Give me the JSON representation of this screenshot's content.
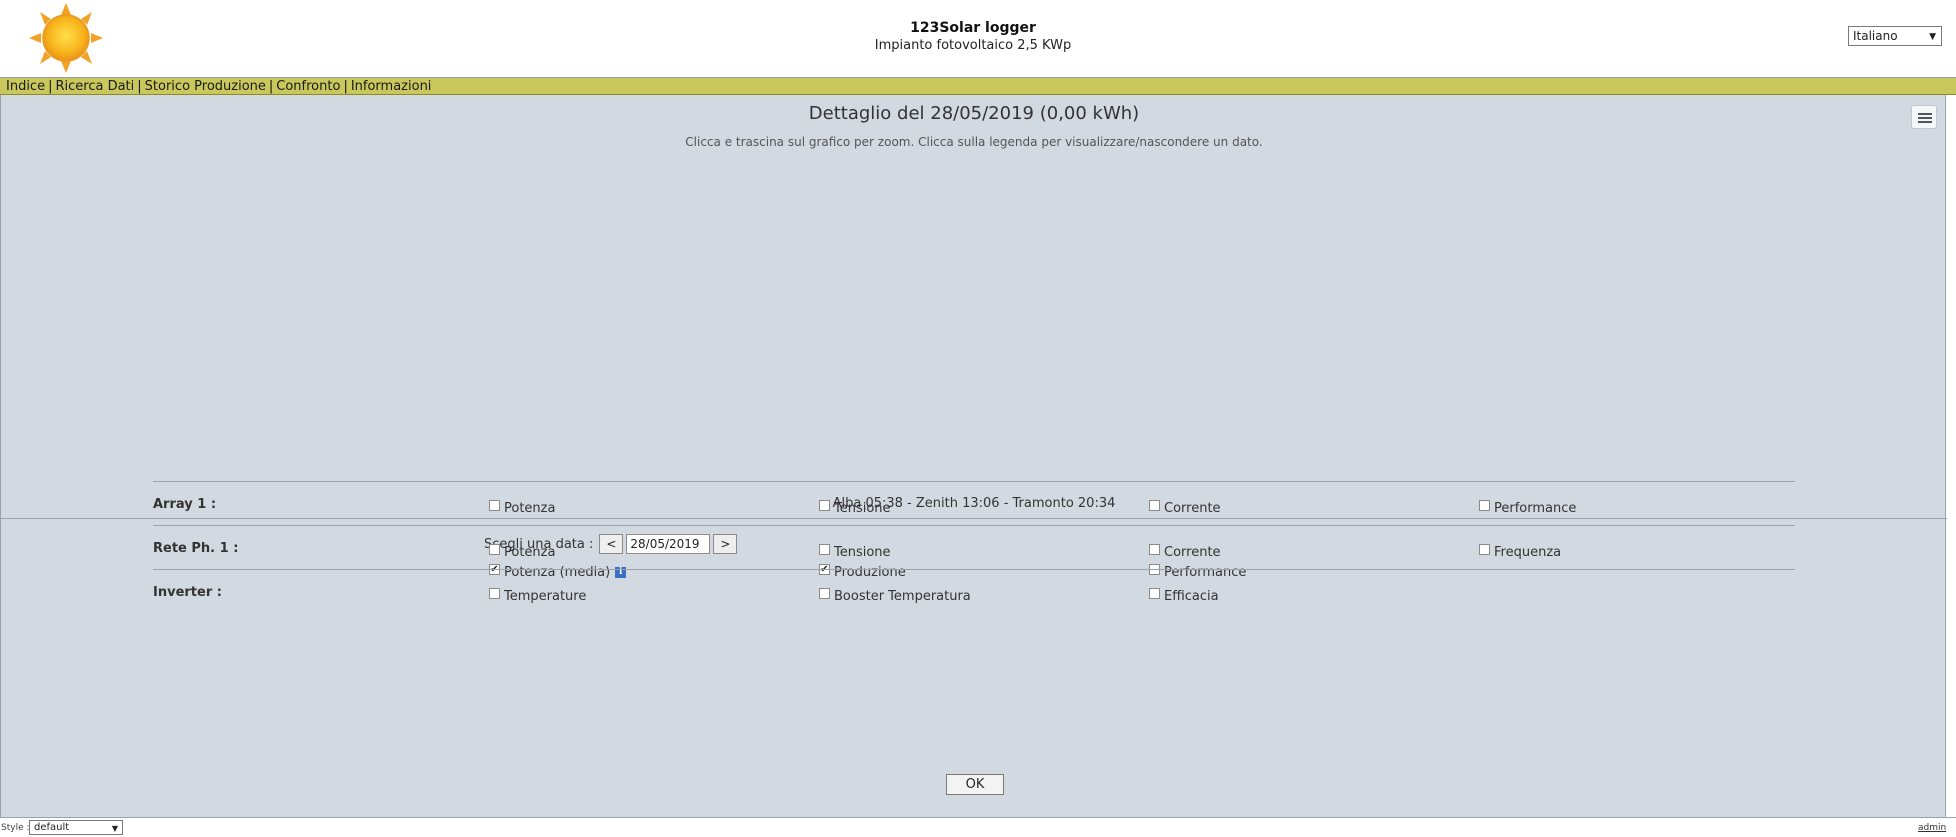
{
  "header": {
    "title": "123Solar logger",
    "subtitle": "Impianto fotovoltaico 2,5 KWp",
    "language_selected": "Italiano",
    "logo_icon": "sun-icon"
  },
  "menu": {
    "items": [
      {
        "label": "Indice"
      },
      {
        "label": "Ricerca Dati"
      },
      {
        "label": "Storico Produzione"
      },
      {
        "label": "Confronto"
      },
      {
        "label": "Informazioni"
      }
    ],
    "separator": "|",
    "background": "#c9c85c"
  },
  "chart": {
    "title": "Dettaglio del 28/05/2019 (0,00 kWh)",
    "subtitle": "Clicca e trascina sul grafico per zoom. Clicca sulla legenda per visualizzare/nascondere un dato.",
    "menu_icon": "hamburger-menu-icon",
    "sun_info": "Alba 05:38 - Zenith 13:06 - Tramonto 20:34"
  },
  "controls": {
    "date_label": "Scegli una data :",
    "prev_label": "<",
    "next_label": ">",
    "date_value": "28/05/2019",
    "main_options": [
      {
        "label": "Potenza (media)",
        "checked": true,
        "info": "i"
      },
      {
        "label": "Produzione",
        "checked": true
      },
      {
        "label": "Performance",
        "checked": false
      }
    ],
    "array1": {
      "label": "Array 1 :",
      "options": [
        {
          "label": "Potenza",
          "checked": false
        },
        {
          "label": "Tensione",
          "checked": false
        },
        {
          "label": "Corrente",
          "checked": false
        },
        {
          "label": "Performance",
          "checked": false
        }
      ]
    },
    "grid": {
      "label": "Rete Ph. 1 :",
      "options": [
        {
          "label": "Potenza",
          "checked": false
        },
        {
          "label": "Tensione",
          "checked": false
        },
        {
          "label": "Corrente",
          "checked": false
        },
        {
          "label": "Frequenza",
          "checked": false
        }
      ]
    },
    "inverter": {
      "label": "Inverter :",
      "options": [
        {
          "label": "Temperature",
          "checked": false
        },
        {
          "label": "Booster Temperatura",
          "checked": false
        },
        {
          "label": "Efficacia",
          "checked": false
        }
      ]
    },
    "ok_label": "OK"
  },
  "footer": {
    "style_label": "Style :",
    "style_selected": "default",
    "admin_label": "admin"
  }
}
